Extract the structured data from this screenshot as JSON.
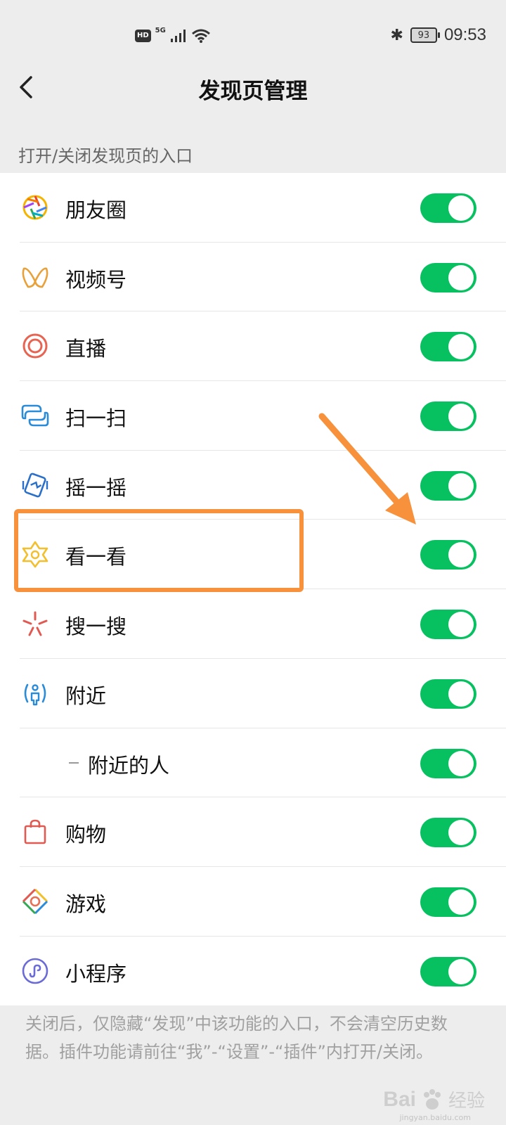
{
  "status_bar": {
    "hd_badge": "HD",
    "network": "5G",
    "battery": "93",
    "time": "09:53"
  },
  "nav": {
    "title": "发现页管理"
  },
  "section_label": "打开/关闭发现页的入口",
  "items": [
    {
      "label": "朋友圈",
      "icon": "moments-aperture-icon",
      "enabled": true
    },
    {
      "label": "视频号",
      "icon": "channels-butterfly-icon",
      "enabled": true
    },
    {
      "label": "直播",
      "icon": "live-ring-icon",
      "enabled": true
    },
    {
      "label": "扫一扫",
      "icon": "scan-icon",
      "enabled": true
    },
    {
      "label": "摇一摇",
      "icon": "shake-phone-icon",
      "enabled": true
    },
    {
      "label": "看一看",
      "icon": "top-stories-star-icon",
      "enabled": true
    },
    {
      "label": "搜一搜",
      "icon": "search-sparkle-icon",
      "enabled": true
    },
    {
      "label": "附近",
      "icon": "nearby-person-icon",
      "enabled": true
    },
    {
      "label": "附近的人",
      "icon": "",
      "enabled": true,
      "sub": true
    },
    {
      "label": "购物",
      "icon": "shopping-bag-icon",
      "enabled": true
    },
    {
      "label": "游戏",
      "icon": "game-diamond-icon",
      "enabled": true
    },
    {
      "label": "小程序",
      "icon": "mini-program-icon",
      "enabled": true
    }
  ],
  "footer_note": "关闭后，仅隐藏“发现”中该功能的入口，不会清空历史数据。插件功能请前往“我”-“设置”-“插件”内打开/关闭。",
  "annotation": {
    "highlight_color": "#f7913b"
  },
  "colors": {
    "toggle_on": "#07c160",
    "background": "#ededed"
  },
  "watermark": {
    "brand": "Bai",
    "text": "经验",
    "url": "jingyan.baidu.com"
  }
}
